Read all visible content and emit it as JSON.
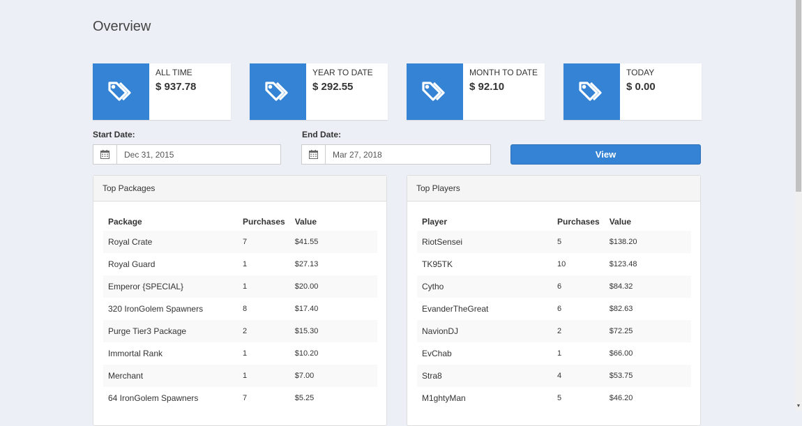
{
  "page": {
    "title": "Overview"
  },
  "stats": [
    {
      "label": "ALL TIME",
      "value": "$ 937.78",
      "icon": "tags-icon"
    },
    {
      "label": "YEAR TO DATE",
      "value": "$ 292.55",
      "icon": "tags-icon"
    },
    {
      "label": "MONTH TO DATE",
      "value": "$ 92.10",
      "icon": "tags-icon"
    },
    {
      "label": "TODAY",
      "value": "$ 0.00",
      "icon": "tags-icon"
    }
  ],
  "filters": {
    "start_label": "Start Date:",
    "start_value": "Dec 31, 2015",
    "end_label": "End Date:",
    "end_value": "Mar 27, 2018",
    "calendar_icon": "calendar-icon",
    "view_label": "View"
  },
  "top_packages": {
    "title": "Top Packages",
    "columns": [
      "Package",
      "Purchases",
      "Value"
    ],
    "rows": [
      [
        "Royal Crate",
        "7",
        "$41.55"
      ],
      [
        "Royal Guard",
        "1",
        "$27.13"
      ],
      [
        "Emperor {SPECIAL}",
        "1",
        "$20.00"
      ],
      [
        "320 IronGolem Spawners",
        "8",
        "$17.40"
      ],
      [
        "Purge Tier3 Package",
        "2",
        "$15.30"
      ],
      [
        "Immortal Rank",
        "1",
        "$10.20"
      ],
      [
        "Merchant",
        "1",
        "$7.00"
      ],
      [
        "64 IronGolem Spawners",
        "7",
        "$5.25"
      ]
    ]
  },
  "top_players": {
    "title": "Top Players",
    "columns": [
      "Player",
      "Purchases",
      "Value"
    ],
    "rows": [
      [
        "RiotSensei",
        "5",
        "$138.20"
      ],
      [
        "TK95TK",
        "10",
        "$123.48"
      ],
      [
        "Cytho",
        "6",
        "$84.32"
      ],
      [
        "EvanderTheGreat",
        "6",
        "$82.63"
      ],
      [
        "NavionDJ",
        "2",
        "$72.25"
      ],
      [
        "EvChab",
        "1",
        "$66.00"
      ],
      [
        "Stra8",
        "4",
        "$53.75"
      ],
      [
        "M1ghtyMan",
        "5",
        "$46.20"
      ]
    ]
  },
  "colors": {
    "accent": "#3483d5",
    "background": "#eceff5"
  }
}
